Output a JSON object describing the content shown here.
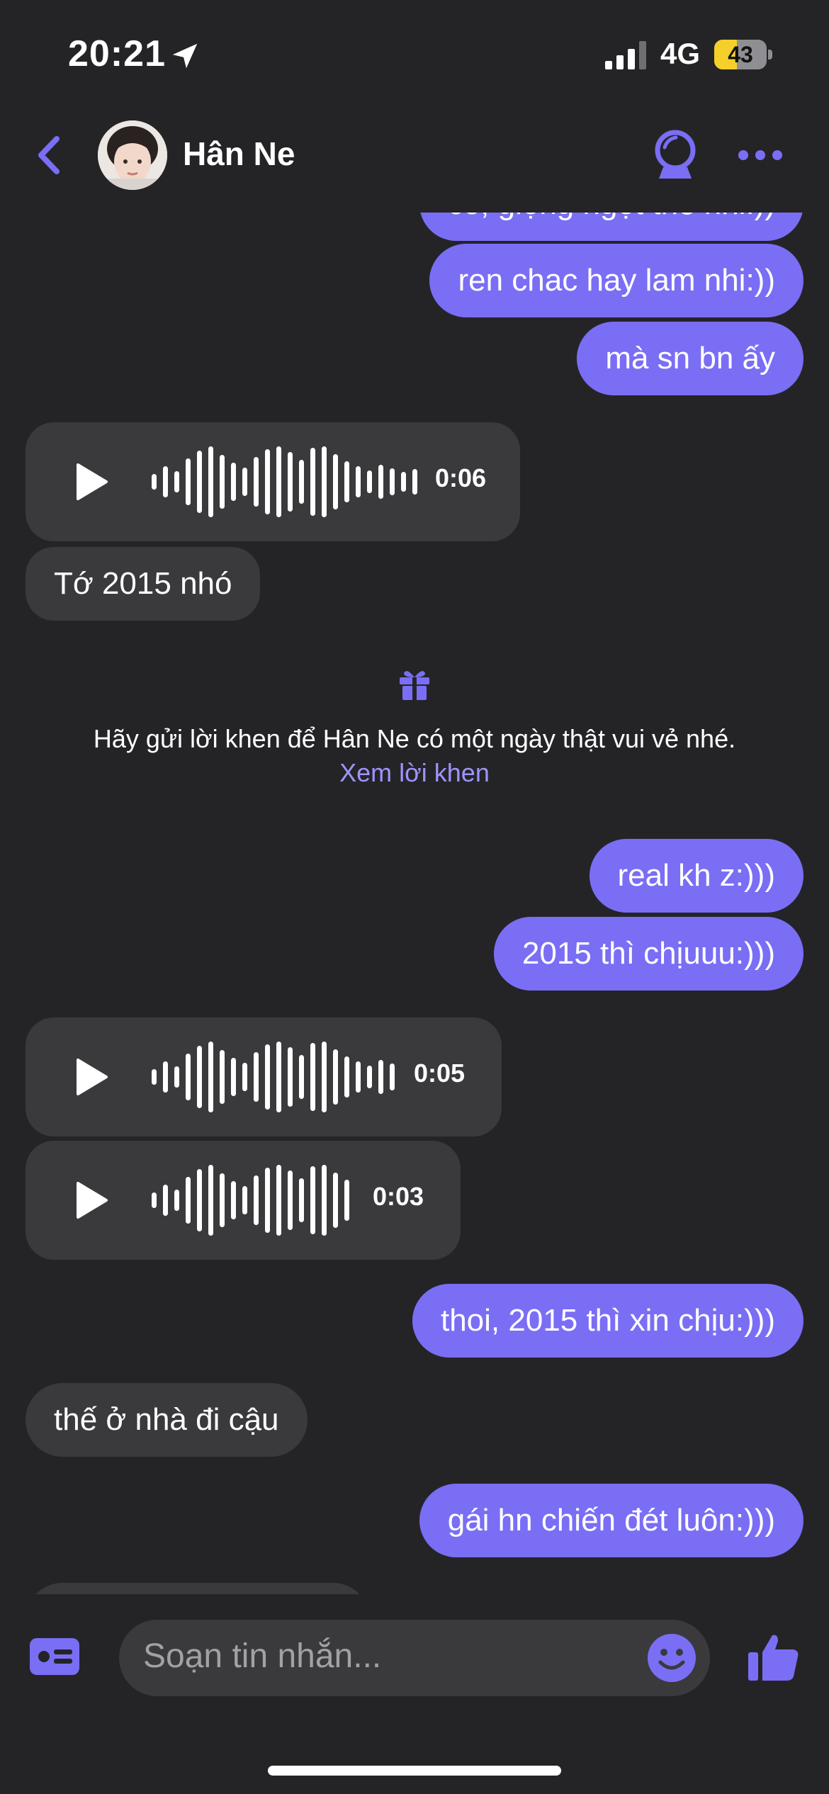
{
  "status_bar": {
    "time": "20:21",
    "network": "4G",
    "battery": "43",
    "battery_level_percent": 43
  },
  "header": {
    "contact_name": "Hân Ne"
  },
  "messages": {
    "out_partial": "có, giọng ngọt thế nhỉ:))",
    "out_1": "ren chac hay lam nhi:))",
    "out_2": "mà sn bn ấy",
    "voice_1_duration": "0:06",
    "in_1": "Tớ 2015 nhó",
    "out_3": "real kh z:)))",
    "out_4": "2015 thì chịuuu:)))",
    "voice_2_duration": "0:05",
    "voice_3_duration": "0:03",
    "out_5": "thoi, 2015 thì xin chịu:)))",
    "in_2": "thế ở nhà đi cậu",
    "out_6": "gái hn chiến đét luôn:)))"
  },
  "birthday_notice": {
    "text": "Hãy gửi lời khen để Hân Ne có một ngày thật vui vẻ nhé.",
    "link": "Xem lời khen"
  },
  "composer": {
    "placeholder": "Soạn tin nhắn..."
  },
  "colors": {
    "accent": "#7a6ef5",
    "background": "#242427",
    "incoming_bubble": "#3a3a3d",
    "link": "#9d94ff"
  },
  "icons": [
    "location-arrow-icon",
    "signal-icon",
    "battery-icon",
    "back-chevron-icon",
    "crystal-ball-icon",
    "more-dots-icon",
    "play-icon",
    "waveform-icon",
    "gift-icon",
    "contact-card-icon",
    "emoji-icon",
    "thumbs-up-icon"
  ]
}
